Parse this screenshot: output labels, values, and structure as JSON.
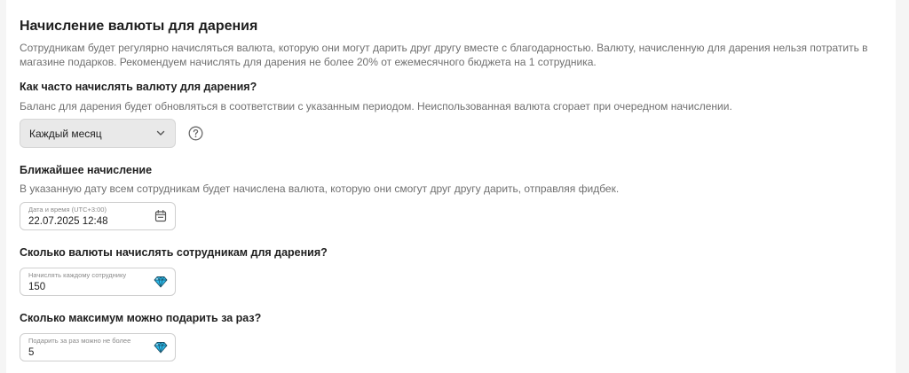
{
  "section": {
    "title": "Начисление валюты для дарения",
    "description": "Сотрудникам будет регулярно начисляться валюта, которую они могут дарить друг другу вместе с благодарностью. Валюту, начисленную для дарения нельзя потратить в магазине подарков. Рекомендуем начислять для дарения не более 20% от ежемесячного бюджета на 1 сотрудника."
  },
  "frequency": {
    "question": "Как часто начислять валюту для дарения?",
    "hint": "Баланс для дарения будет обновляться в соответствии с указанным периодом. Неиспользованная валюта сгорает при очередном начислении.",
    "selected": "Каждый месяц",
    "chevron_icon": "chevron-down-icon",
    "help_icon": "question-circle-icon"
  },
  "next_accrual": {
    "question": "Ближайшее начисление",
    "hint": "В указанную дату всем сотрудникам будет начислена валюта, которую они смогут друг другу дарить, отправляя фидбек.",
    "field_label": "Дата и время (UTC+3:00)",
    "field_value": "22.07.2025 12:48",
    "icon": "calendar-icon"
  },
  "amount": {
    "question": "Сколько валюты начислять сотрудникам для дарения?",
    "field_label": "Начислять каждому сотруднику",
    "field_value": "150",
    "icon": "diamond-icon"
  },
  "max_gift": {
    "question": "Сколько максимум можно подарить за раз?",
    "field_label": "Подарить за раз можно не более",
    "field_value": "5",
    "icon": "diamond-icon"
  },
  "colors": {
    "diamond": "#2bb8e8",
    "text_primary": "#1f1f1f",
    "text_secondary": "#707070"
  }
}
